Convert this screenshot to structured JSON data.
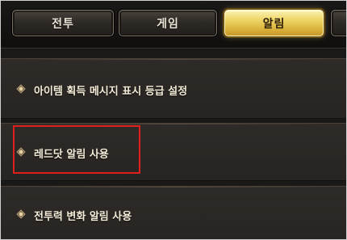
{
  "tabs": [
    {
      "label": "전투",
      "active": false
    },
    {
      "label": "게임",
      "active": false
    },
    {
      "label": "알림",
      "active": true
    }
  ],
  "settings": [
    {
      "label": "아이템 획득 메시지 표시 등급 설정"
    },
    {
      "label": "레드닷 알림 사용",
      "highlighted": true
    },
    {
      "label": "전투력 변화 알림 사용"
    }
  ],
  "colors": {
    "active_tab": "#f0d76a",
    "highlight_box": "#e0201e",
    "background": "#262320"
  },
  "icons": {
    "row_bullet": "diamond-bullet-icon"
  }
}
